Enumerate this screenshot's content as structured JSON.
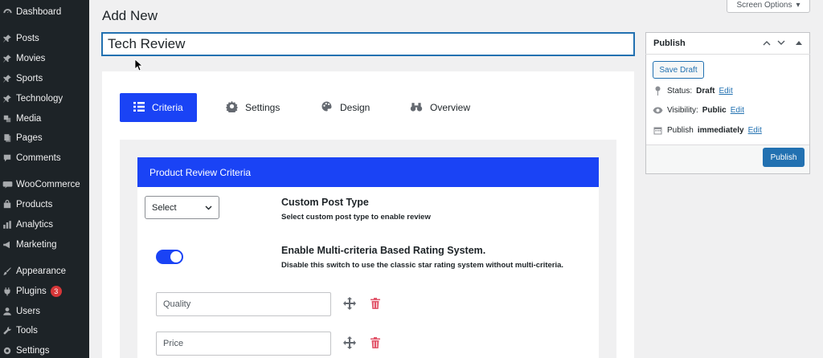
{
  "sidebar": {
    "items": [
      {
        "label": "Dashboard",
        "icon": "dashboard-icon"
      },
      {
        "label": "Posts",
        "icon": "pin-icon"
      },
      {
        "label": "Movies",
        "icon": "pin-icon"
      },
      {
        "label": "Sports",
        "icon": "pin-icon"
      },
      {
        "label": "Technology",
        "icon": "pin-icon"
      },
      {
        "label": "Media",
        "icon": "media-icon"
      },
      {
        "label": "Pages",
        "icon": "pages-icon"
      },
      {
        "label": "Comments",
        "icon": "comment-icon"
      },
      {
        "label": "WooCommerce",
        "icon": "woo-icon"
      },
      {
        "label": "Products",
        "icon": "products-icon"
      },
      {
        "label": "Analytics",
        "icon": "analytics-icon"
      },
      {
        "label": "Marketing",
        "icon": "megaphone-icon"
      },
      {
        "label": "Appearance",
        "icon": "brush-icon"
      },
      {
        "label": "Plugins",
        "icon": "plugin-icon",
        "badge": "3"
      },
      {
        "label": "Users",
        "icon": "users-icon"
      },
      {
        "label": "Tools",
        "icon": "wrench-icon"
      },
      {
        "label": "Settings",
        "icon": "settings-icon"
      }
    ]
  },
  "header": {
    "title": "Add New",
    "screen_options": "Screen Options"
  },
  "editor": {
    "post_title": "Tech Review"
  },
  "tabs": [
    {
      "label": "Criteria",
      "icon": "list-icon",
      "active": true
    },
    {
      "label": "Settings",
      "icon": "gear-icon",
      "active": false
    },
    {
      "label": "Design",
      "icon": "palette-icon",
      "active": false
    },
    {
      "label": "Overview",
      "icon": "binoculars-icon",
      "active": false
    }
  ],
  "criteria_card": {
    "title": "Product Review Criteria",
    "post_type": {
      "select_value": "Select",
      "title": "Custom Post Type",
      "desc": "Select custom post type to enable review"
    },
    "multi_criteria": {
      "title": "Enable Multi-criteria Based Rating System.",
      "desc": "Disable this switch to use the classic star rating system without multi-criteria.",
      "enabled": true
    },
    "criteria": [
      {
        "value": "Quality"
      },
      {
        "value": "Price"
      }
    ]
  },
  "publish": {
    "title": "Publish",
    "save_draft": "Save Draft",
    "status_label": "Status:",
    "status_value": "Draft",
    "visibility_label": "Visibility:",
    "visibility_value": "Public",
    "schedule_label": "Publish",
    "schedule_value": "immediately",
    "edit_label": "Edit",
    "publish_button": "Publish"
  },
  "colors": {
    "sidebar_bg": "#1d2327",
    "accent": "#1a43f5",
    "wp_blue": "#2271b1",
    "trash": "#e2566b"
  }
}
